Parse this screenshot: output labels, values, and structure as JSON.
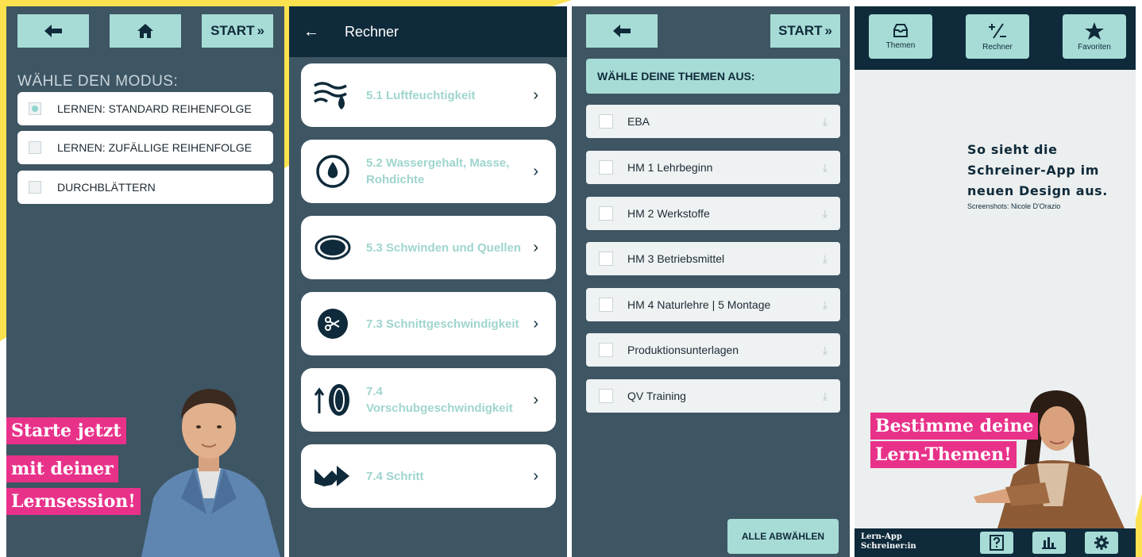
{
  "panel1": {
    "start_label": "START",
    "mode_title": "WÄHLE DEN MODUS:",
    "modes": [
      {
        "label": "LERNEN: STANDARD REIHENFOLGE",
        "selected": true
      },
      {
        "label": "LERNEN: ZUFÄLLIGE REIHENFOLGE",
        "selected": false
      },
      {
        "label": "DURCHBLÄTTERN",
        "selected": false
      }
    ],
    "promo": [
      "Starte jetzt",
      "mit deiner",
      "Lernsession!"
    ]
  },
  "panel2": {
    "title": "Rechner",
    "items": [
      {
        "label": "5.1 Luftfeuchtigkeit",
        "icon": "humidity-icon"
      },
      {
        "label": "5.2 Wassergehalt, Masse, Rohdichte",
        "icon": "water-drop-icon"
      },
      {
        "label": "5.3 Schwinden und Quellen",
        "icon": "oval-icon"
      },
      {
        "label": "7.3 Schnittgeschwindigkeit",
        "icon": "saw-blade-icon"
      },
      {
        "label": "7.4 Vorschubgeschwindigkeit",
        "icon": "feed-roller-icon"
      },
      {
        "label": "7.4 Schritt",
        "icon": "step-arrow-icon"
      }
    ]
  },
  "panel3": {
    "start_label": "START",
    "topics_title": "WÄHLE DEINE THEMEN AUS:",
    "topics": [
      "EBA",
      "HM 1 Lehrbeginn",
      "HM 2 Werkstoffe",
      "HM 3 Betriebsmittel",
      "HM 4 Naturlehre | 5 Montage",
      "Produktionsunterlagen",
      "QV Training"
    ],
    "deselect_label": "ALLE ABWÄHLEN"
  },
  "panel4": {
    "nav": [
      {
        "label": "Themen",
        "icon": "inbox-icon"
      },
      {
        "label": "Rechner",
        "icon": "plus-minus-icon"
      },
      {
        "label": "Favoriten",
        "icon": "star-icon"
      }
    ],
    "caption_lines": [
      "So sieht die",
      "Schreiner-App im",
      "neuen Design aus."
    ],
    "credit": "Screenshots: Nicole D'Orazio",
    "promo": [
      "Bestimme deine",
      "Lern-Themen!"
    ],
    "footer_app": [
      "Lern-App",
      "Schreiner:in"
    ]
  },
  "colors": {
    "navy": "#0f2a3a",
    "slate": "#3e5563",
    "mint": "#a7dcd6",
    "pink": "#e8328a",
    "yellow": "#fde24f"
  }
}
